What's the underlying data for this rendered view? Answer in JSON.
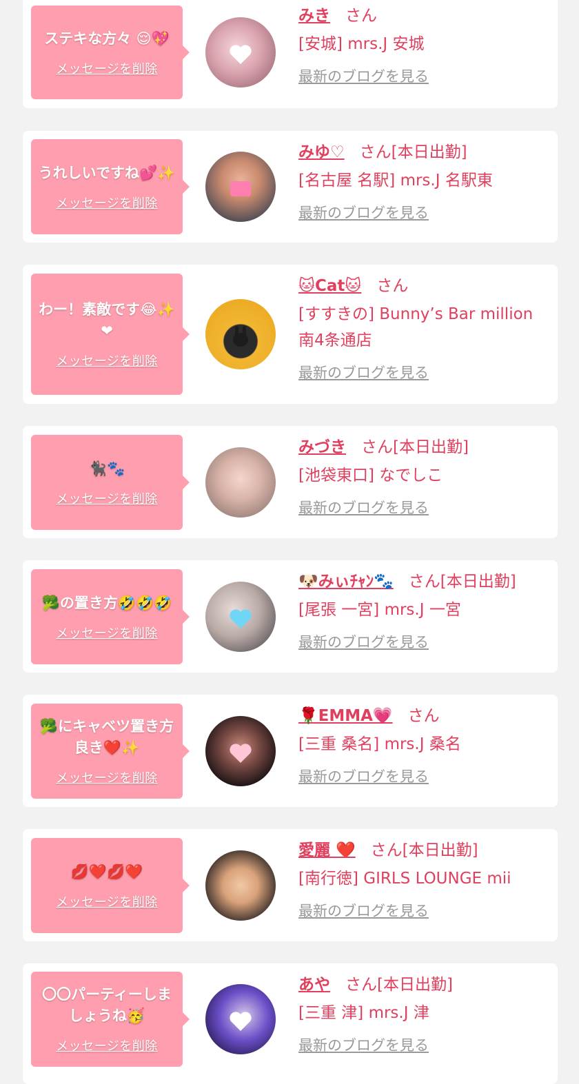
{
  "theme": {
    "accent": "#e0405d",
    "bubble": "#ff9eae",
    "link_gray": "#999999",
    "background": "#f2f2f2"
  },
  "entries": [
    {
      "message": "ステキな方々 😌💖",
      "delete_label": "メッセージを削除",
      "name": "みき",
      "suffix": "さん",
      "shop": "[安城] mrs.J 安城",
      "blog_label": "最新のブログを見る"
    },
    {
      "message": "うれしいですね💕✨",
      "delete_label": "メッセージを削除",
      "name": "みゆ♡",
      "suffix": "さん[本日出勤]",
      "shop": "[名古屋 名駅] mrs.J 名駅東",
      "blog_label": "最新のブログを見る"
    },
    {
      "message": "わー！素敵です😂✨❤",
      "delete_label": "メッセージを削除",
      "name": "🐱Cat🐱",
      "suffix": "さん",
      "shop": "[すすきの] Bunny’s Bar million 南4条通店",
      "blog_label": "最新のブログを見る"
    },
    {
      "message": "🐈‍⬛🐾",
      "delete_label": "メッセージを削除",
      "name": "みづき",
      "suffix": "さん[本日出勤]",
      "shop": "[池袋東口] なでしこ",
      "blog_label": "最新のブログを見る"
    },
    {
      "message": "🥦の置き方🤣🤣🤣",
      "delete_label": "メッセージを削除",
      "name": "🐶みぃﾁｬﾝ🐾",
      "suffix": "さん[本日出勤]",
      "shop": "[尾張 一宮] mrs.J 一宮",
      "blog_label": "最新のブログを見る"
    },
    {
      "message": "🥦にキャベツ置き方良き❤️✨",
      "delete_label": "メッセージを削除",
      "name": "🌹EMMA💗",
      "suffix": "さん",
      "shop": "[三重 桑名] mrs.J 桑名",
      "blog_label": "最新のブログを見る"
    },
    {
      "message": "💋❤️💋❤️",
      "delete_label": "メッセージを削除",
      "name": "愛麗 ❤️",
      "suffix": "さん[本日出勤]",
      "shop": "[南行徳] GIRLS LOUNGE mii",
      "blog_label": "最新のブログを見る"
    },
    {
      "message": "〇〇パーティーしましょうね🥳",
      "delete_label": "メッセージを削除",
      "name": "あや",
      "suffix": "さん[本日出勤]",
      "shop": "[三重 津] mrs.J 津",
      "blog_label": "最新のブログを見る"
    }
  ]
}
